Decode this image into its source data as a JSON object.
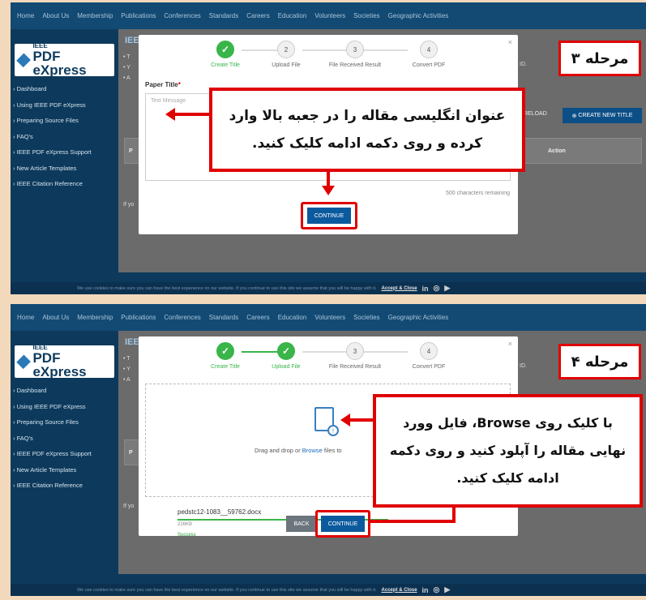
{
  "nav": {
    "items": [
      "Home",
      "About Us",
      "Membership",
      "Publications",
      "Conferences",
      "Standards",
      "Careers",
      "Education",
      "Volunteers",
      "Societies",
      "Geographic Activities"
    ]
  },
  "logo": {
    "ieee": "IEEE",
    "pdf": "PDF eXpress"
  },
  "sidebar": {
    "items": [
      "Dashboard",
      "Using IEEE PDF eXpress",
      "Preparing Source Files",
      "FAQ's",
      "IEEE PDF eXpress Support",
      "New Article Templates",
      "IEEE Citation Reference"
    ]
  },
  "content": {
    "title_stub": "IEE",
    "bullets": [
      "• T",
      "• Y",
      "• A"
    ],
    "id_stub": "ID.",
    "reload": "RELOAD",
    "new_title": "CREATE NEW TITLE",
    "col_p": "P",
    "col_action": "Action",
    "if_you": "If yo"
  },
  "footer": {
    "cookie": "We use cookies to make sure you can have the best experience on our website. If you continue to use this site we assume that you will be happy with it.",
    "accept": "Accept & Close",
    "social": [
      "in",
      "◎",
      "▶"
    ]
  },
  "modal": {
    "close": "×",
    "steps": [
      {
        "num": "2",
        "label": "Upload File"
      },
      {
        "num": "3",
        "label": "File Received Result"
      },
      {
        "num": "4",
        "label": "Convert PDF"
      }
    ],
    "step1_label": "Create Title",
    "check": "✓",
    "paper_title_label": "Paper Title",
    "required": "*",
    "placeholder": "Text Message",
    "chars_remaining": "500 characters remaining",
    "continue": "CONTINUE",
    "back": "BACK",
    "drag_text_pre": "Drag and drop or ",
    "browse": "Browse",
    "drag_text_post": " files to",
    "file_name": "pedstc12-1083__59762.docx",
    "file_size": "226KB",
    "file_status": "Success",
    "upload_progress": 1
  },
  "annotations": {
    "stage3": "مرحله ۳",
    "stage4": "مرحله ۴",
    "callout1": "عنوان انگلیسی مقاله را در جعبه بالا وارد کرده و روی دکمه ادامه کلیک کنید.",
    "callout2": "با کلیک روی Browse، فایل وورد نهایی مقاله را آپلود کنید و روی دکمه ادامه کلیک کنید."
  }
}
